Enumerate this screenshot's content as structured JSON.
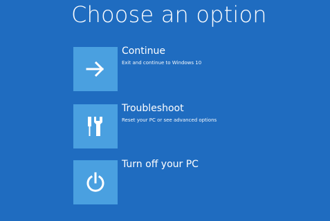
{
  "page": {
    "title": "Choose an option"
  },
  "options": [
    {
      "label": "Continue",
      "description": "Exit and continue to Windows 10",
      "icon": "arrow-right-icon"
    },
    {
      "label": "Troubleshoot",
      "description": "Reset your PC or see advanced options",
      "icon": "tools-icon"
    },
    {
      "label": "Turn off your PC",
      "description": "",
      "icon": "power-icon"
    }
  ],
  "colors": {
    "background": "#1f6cc0",
    "tile": "#4aa0e0",
    "text": "#ffffff"
  }
}
